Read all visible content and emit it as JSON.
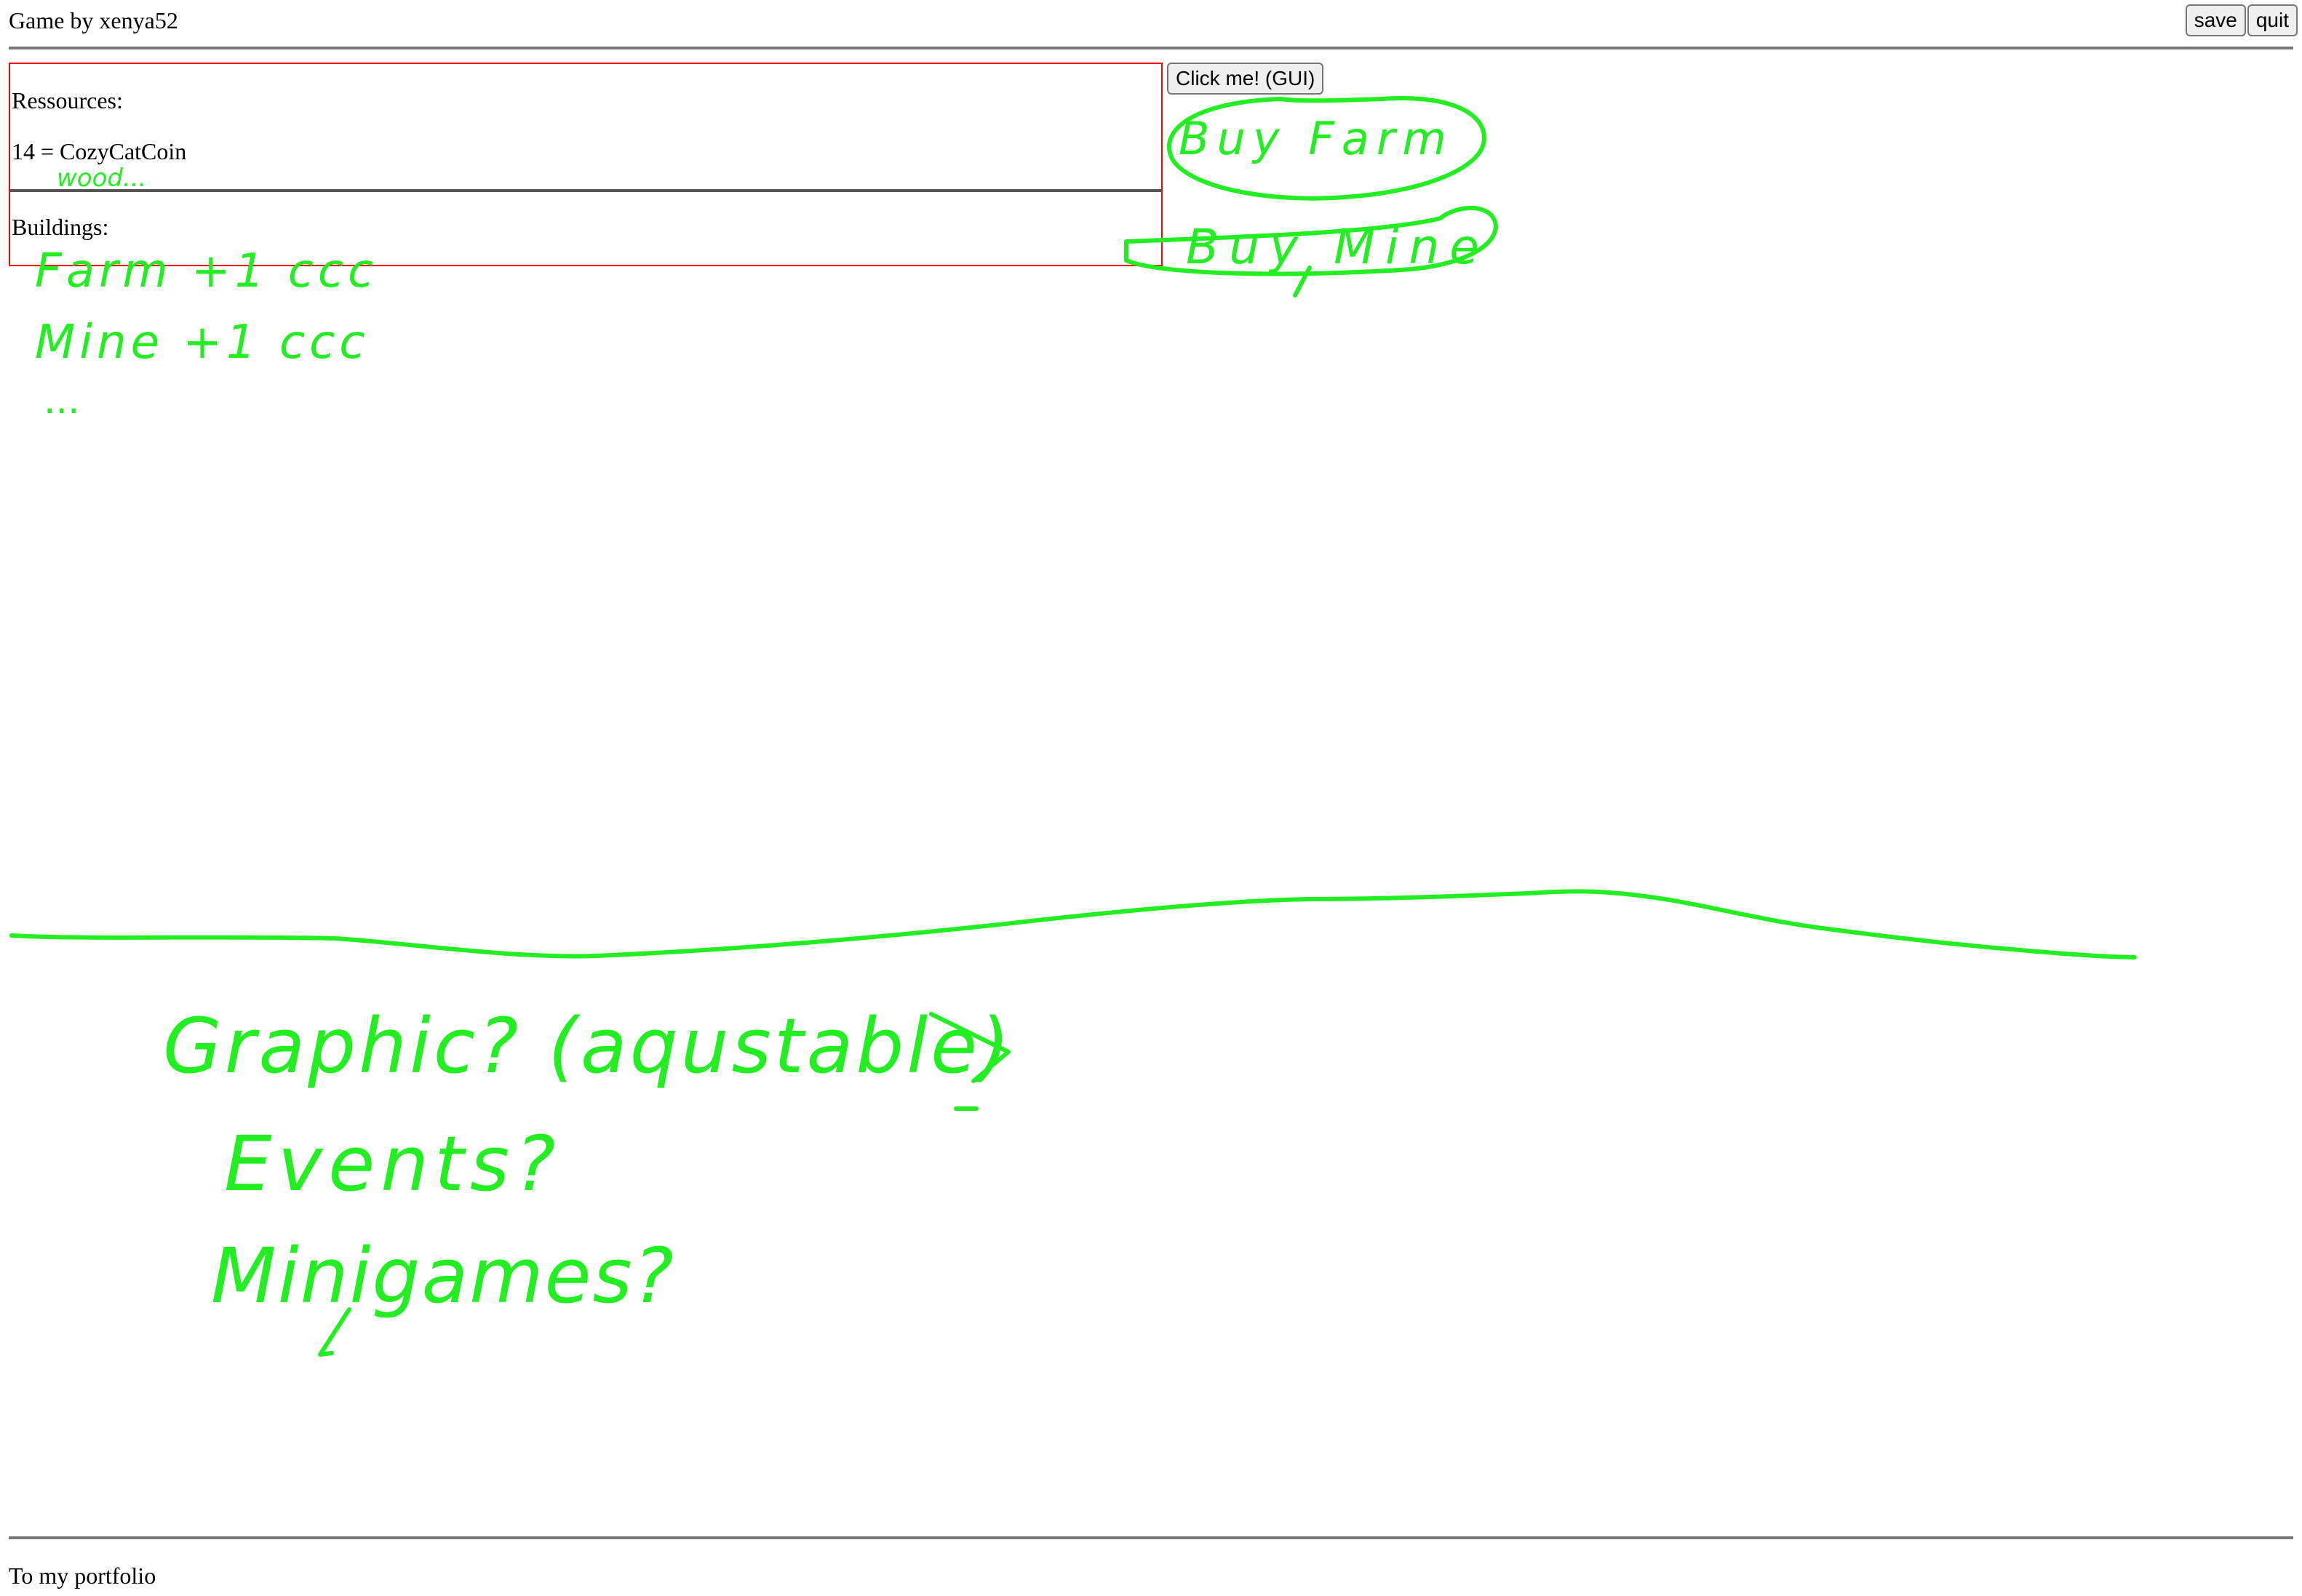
{
  "header": {
    "title": "Game by xenya52",
    "save_label": "save",
    "quit_label": "quit"
  },
  "resources": {
    "label": "Ressources:",
    "value": "14 = CozyCatCoin"
  },
  "buildings": {
    "label": "Buildings:"
  },
  "gui_button_label": "Click me! (GUI)",
  "footer": {
    "link_label": "To my portfolio"
  },
  "sketch": {
    "color": "#22ee22",
    "wood_note": "wood...",
    "buy_farm": "Buy Farm",
    "buy_mine": "Buy Mine",
    "farm_line": "Farm +1 ccc",
    "mine_line": "Mine +1 ccc",
    "more": "...",
    "graphic_line": "Graphic? (aqustable)",
    "events_line": "Events?",
    "minigames_line": "Minigames?"
  }
}
